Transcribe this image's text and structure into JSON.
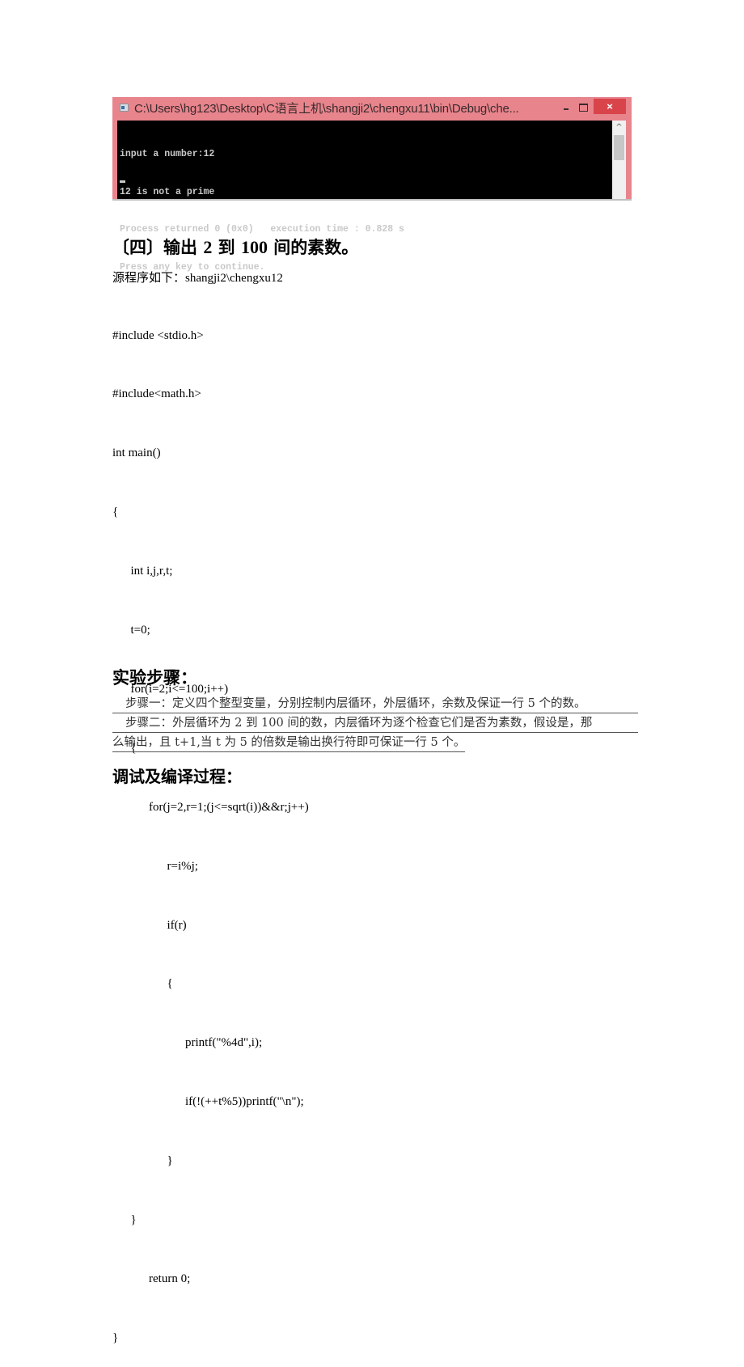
{
  "console": {
    "title": "C:\\Users\\hg123\\Desktop\\C语言上机\\shangji2\\chengxu11\\bin\\Debug\\che...",
    "close_glyph": "×",
    "scroll_up_glyph": "^",
    "output_lines": [
      "input a number:12",
      "12 is not a prime",
      "Process returned 0 (0x0)   execution time : 0.828 s",
      "Press any key to continue."
    ],
    "colors": {
      "titlebar": "#e8848c",
      "close_button": "#d9444b",
      "screen": "#000000",
      "text": "#c9c9c9"
    }
  },
  "section": {
    "prefix": "〔四〕输出 ",
    "num1": "2",
    "mid": " 到 ",
    "num2": "100",
    "suffix": " 间的素数。"
  },
  "source_label": "源程序如下：shangji2\\chengxu12",
  "code_lines": [
    "#include <stdio.h>",
    "#include<math.h>",
    "int main()",
    "{",
    "      int i,j,r,t;",
    "      t=0;",
    "      for(i=2;i<=100;i++)",
    "      {",
    "            for(j=2,r=1;(j<=sqrt(i))&&r;j++)",
    "                  r=i%j;",
    "                  if(r)",
    "                  {",
    "                        printf(\"%4d\",i);",
    "                        if(!(++t%5))printf(\"\\n\");",
    "                  }",
    "      }",
    "            return 0;",
    "}"
  ],
  "steps_heading": "实验步骤：",
  "steps": {
    "line1": "步骤一：定义四个整型变量，分别控制内层循环，外层循环，余数及保证一行 5 个的数。",
    "line2": "步骤二：外层循环为 2 到 100 间的数，内层循环为逐个检查它们是否为素数，假设是，那",
    "line3": "么输出，且 t+1,当 t 为 5 的倍数是输出换行符即可保证一行 5 个。"
  },
  "debug_heading": "调试及编译过程："
}
